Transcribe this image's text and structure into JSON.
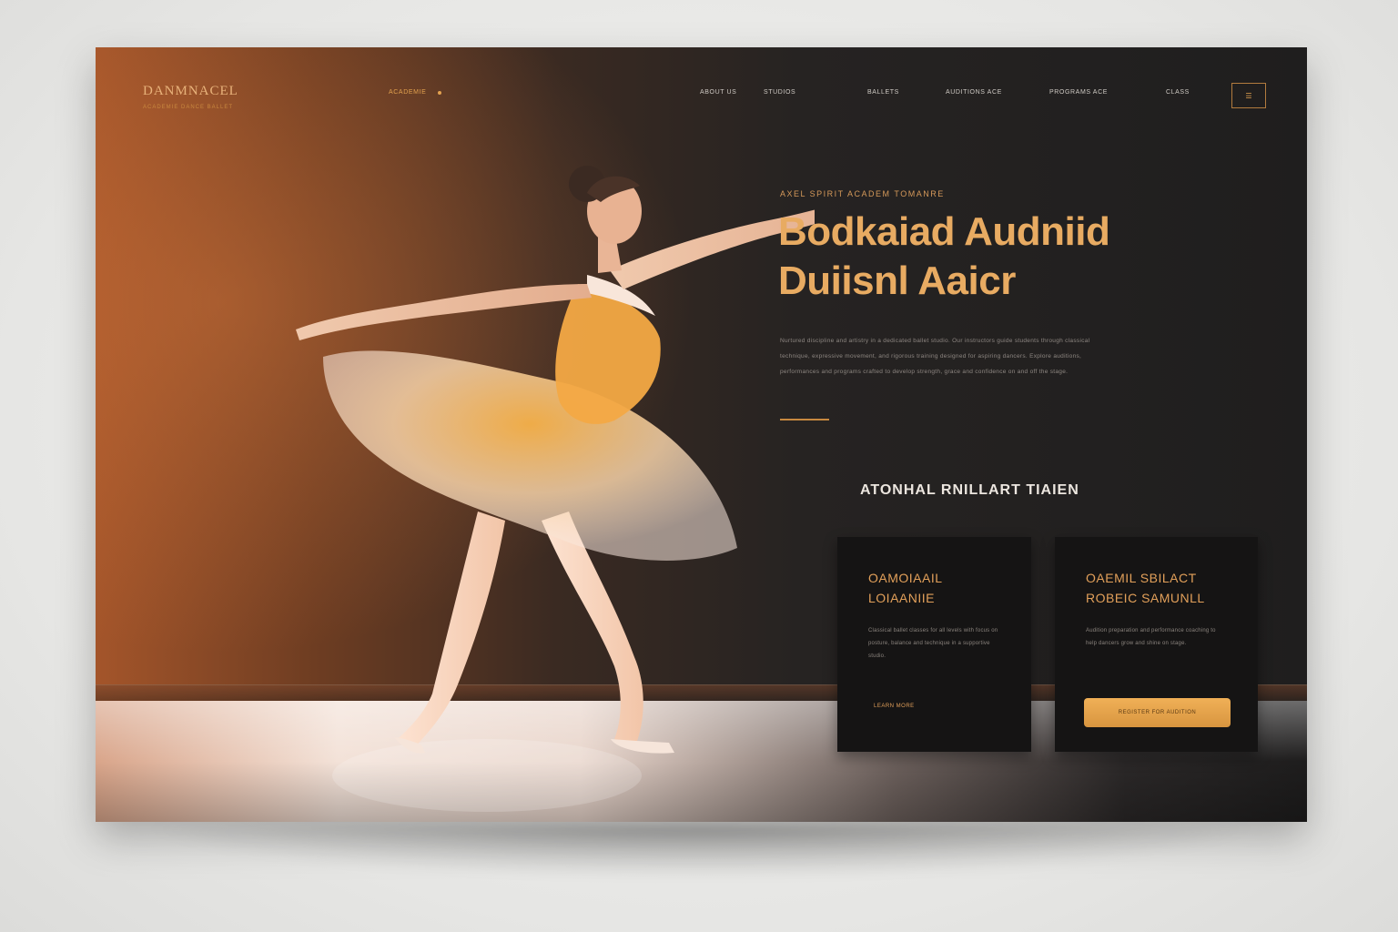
{
  "brand": {
    "name": "DANMNACEL",
    "tagline": "ACADEMIE DANCE BALLET"
  },
  "nav": {
    "items": [
      {
        "label": "ACADEMIE",
        "accent": true
      },
      {
        "label": "ABOUT US",
        "accent": false
      },
      {
        "label": "STUDIOS",
        "accent": false
      },
      {
        "label": "BALLETS",
        "accent": false
      },
      {
        "label": "AUDITIONS ACE",
        "accent": false
      },
      {
        "label": "PROGRAMS ACE",
        "accent": false
      },
      {
        "label": "CLASS",
        "accent": false
      }
    ],
    "menu_label": "☰"
  },
  "hero": {
    "eyebrow": "AXEL   SPIRIT ACADEM   TOMANRE",
    "title": "Bodkaiad Audniid\nDuiisnl Aaicr",
    "body": "Nurtured discipline and artistry in a dedicated ballet studio. Our instructors guide students through classical technique, expressive movement, and rigorous training designed for aspiring dancers. Explore auditions, performances and programs crafted to develop strength, grace and confidence on and off the stage.",
    "section_title": "ATONHAL RNILLART TIAIEN"
  },
  "cards": [
    {
      "title": "OAMOIAAIL\nLOIAANIIE",
      "body": "Classical ballet classes for all levels with focus on posture, balance and technique in a supportive studio.",
      "link": "LEARN MORE"
    },
    {
      "title": "OAEMIL SBILACT\nROBEIC SAMUNLL",
      "body": "Audition preparation and performance coaching to help dancers grow and shine on stage.",
      "button": "REGISTER FOR AUDITION"
    }
  ],
  "colors": {
    "accent": "#e3a24f",
    "background_dark": "#1f1e1e",
    "warm_glow": "#a4552a",
    "card": "#151414"
  }
}
